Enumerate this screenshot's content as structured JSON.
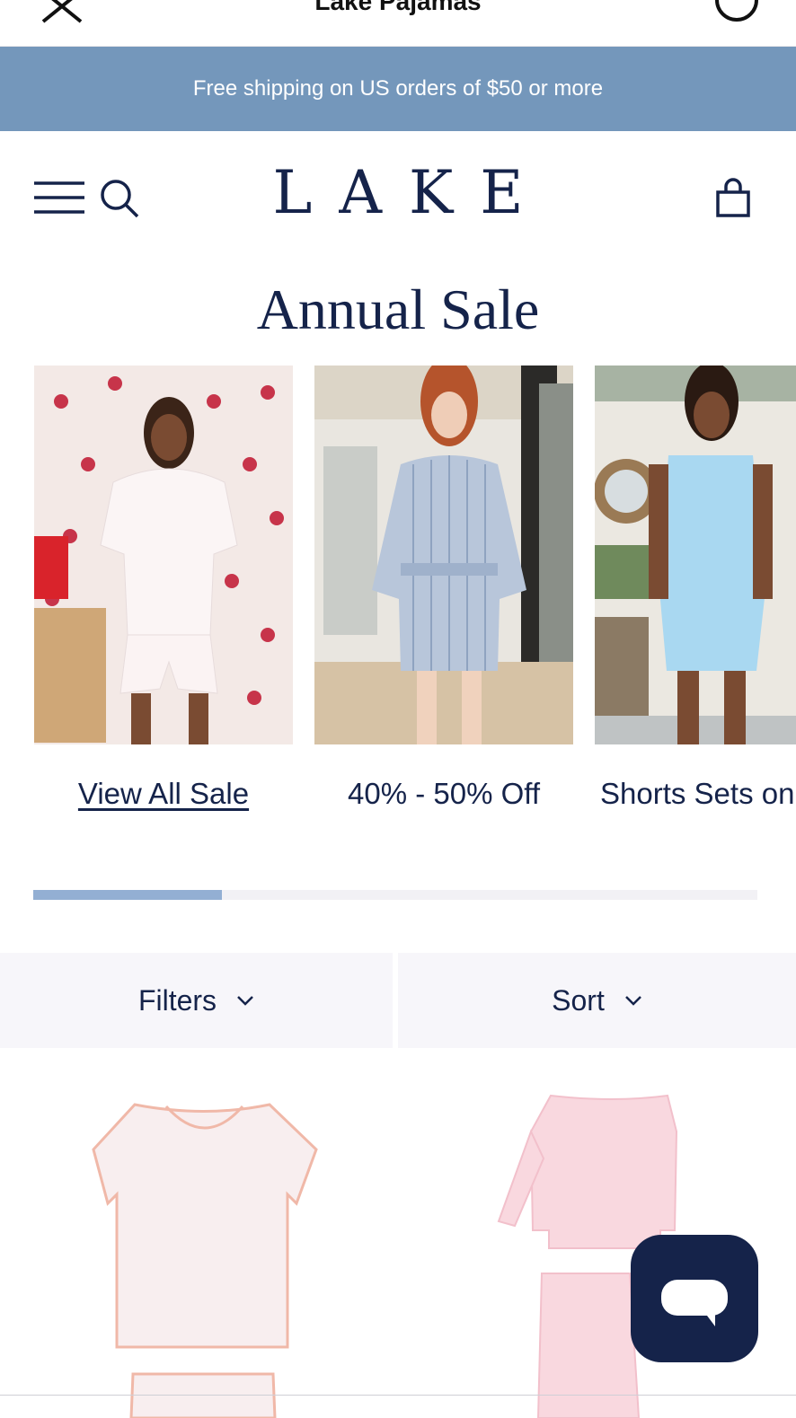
{
  "browser": {
    "title": "Lake Pajamas",
    "close_icon": "close-icon",
    "reload_icon": "reload-icon"
  },
  "promo": {
    "text": "Free shipping on US orders of $50 or more",
    "background_color": "#7497bb"
  },
  "header": {
    "logo_text": "LAKE",
    "menu_icon": "hamburger-menu-icon",
    "search_icon": "search-icon",
    "bag_icon": "shopping-bag-icon"
  },
  "page": {
    "title": "Annual Sale"
  },
  "carousel": {
    "cards": [
      {
        "label": "View All Sale",
        "image": "model-white-tee-shorts-set"
      },
      {
        "label": "40% - 50% Off",
        "image": "model-blue-striped-robe"
      },
      {
        "label": "Shorts Sets on Sale",
        "image": "model-light-blue-cami-set"
      }
    ],
    "progress_fraction": 0.26
  },
  "controls": {
    "filters_label": "Filters",
    "sort_label": "Sort",
    "chevron_icon": "chevron-down-icon"
  },
  "products": [
    {
      "image": "pink-print-short-sleeve-pajama"
    },
    {
      "image": "pink-striped-long-sleeve-pajama"
    }
  ],
  "chat": {
    "icon": "chat-bubble-icon",
    "background_color": "#15234a"
  },
  "colors": {
    "navy": "#15234a",
    "accent_blue": "#93afd3",
    "panel_bg": "#f7f6fa"
  }
}
